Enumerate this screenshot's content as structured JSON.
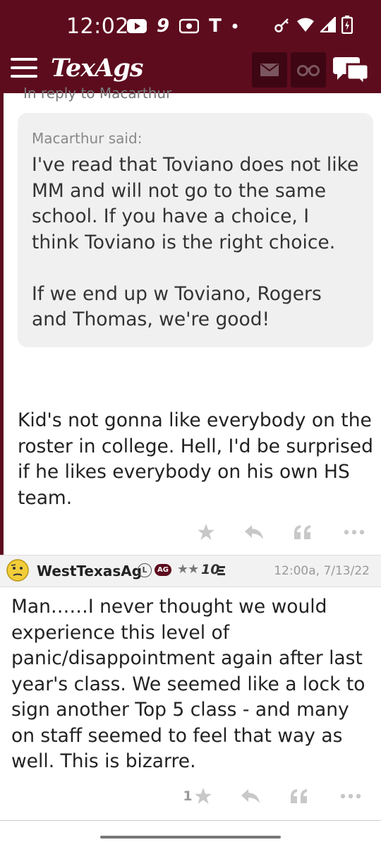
{
  "status_bar": {
    "time": "12:02",
    "icons": [
      "youtube-icon",
      "nine-icon",
      "radio-icon",
      "t-icon",
      "dot-icon",
      "key-icon",
      "wifi-icon",
      "signal-icon",
      "battery-icon"
    ],
    "nine_glyph": "9",
    "t_glyph": "T"
  },
  "nav": {
    "logo": "TexAgs",
    "icons": [
      "menu-icon",
      "mail-icon",
      "binoculars-icon",
      "chat-icon"
    ]
  },
  "posts": [
    {
      "cutoff_text": "In reply to Macarthur",
      "quote": {
        "attribution": "Macarthur said:",
        "text": "I've read that Toviano does not like MM and will not go to the same school. If you have a choice, I think Toviano is the right choice.\n\nIf we end up w Toviano, Rogers and Thomas, we're good!"
      },
      "body": "Kid's not gonna like everybody on the roster in college. Hell, I'd be surprised if he likes everybody on his own HS team."
    },
    {
      "username": "WestTexasAg",
      "badge_l": "L",
      "badge_ag": "AG",
      "stars": "★★",
      "rank": "10",
      "timestamp": "12:00a, 7/13/22",
      "body": "Man……I never thought we would experience this level of panic/disappointment again after last year's class. We seemed like a lock to sign another Top 5 class - and many on staff seemed to feel that way as well. This is bizarre.",
      "star_count": "1"
    }
  ],
  "colors": {
    "brand": "#5d0c1e",
    "brand_dark": "#3e0613",
    "quote_bg": "#f0f0f0",
    "header_bg": "#f2f2f2"
  }
}
